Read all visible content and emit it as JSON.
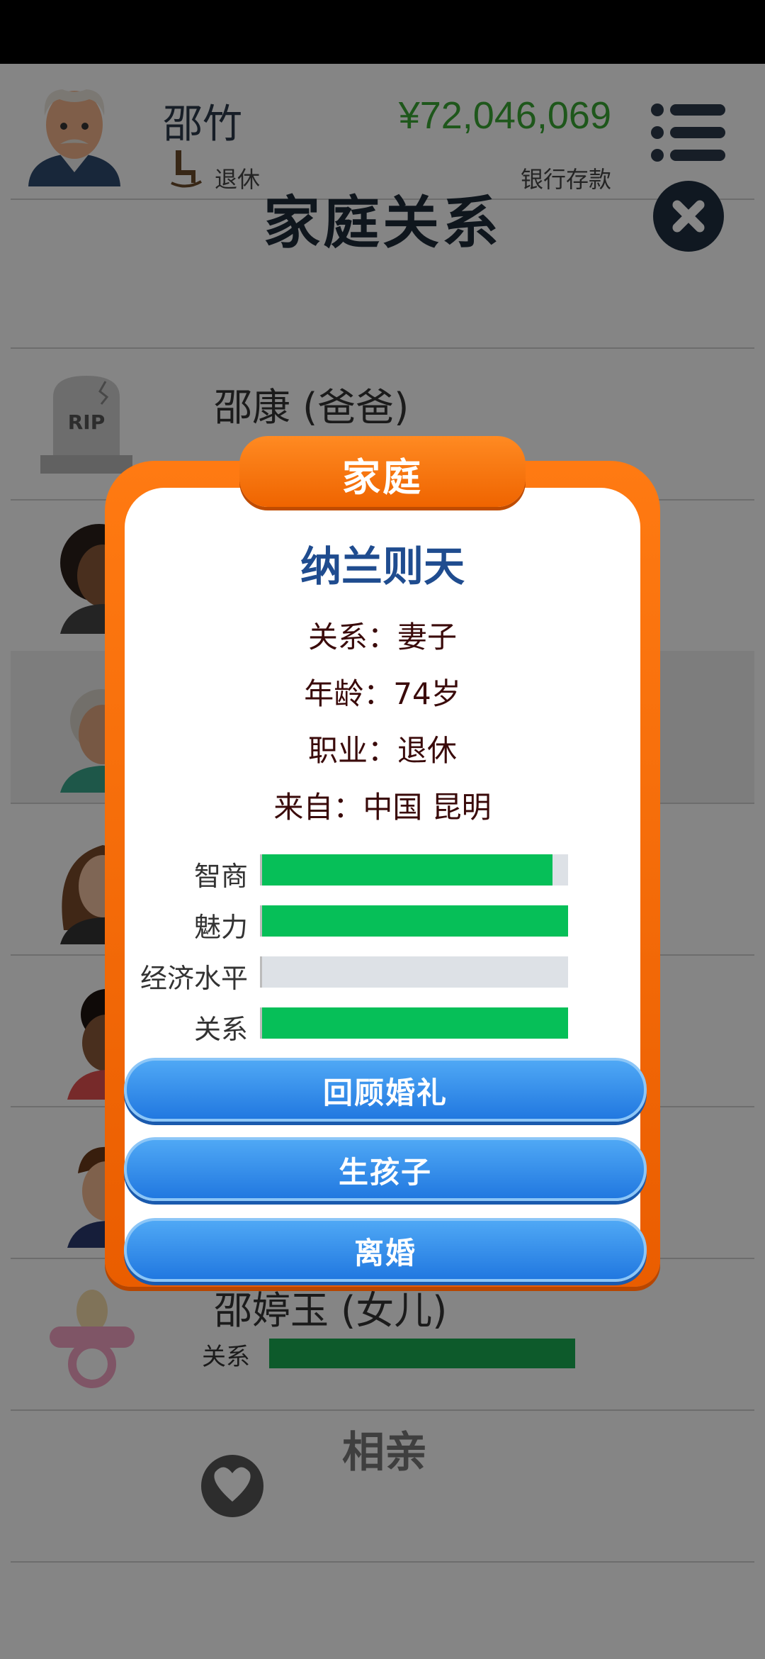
{
  "header": {
    "user_name": "邵竹",
    "job": "退休",
    "money": "¥72,046,069",
    "money_label": "银行存款",
    "avatar_icon": "old-man-avatar-icon",
    "job_icon": "rocking-chair-icon",
    "menu_icon": "menu-list-icon"
  },
  "page": {
    "title": "家庭关系",
    "close_icon": "close-icon"
  },
  "family": [
    {
      "name": "邵康 (爸爸)",
      "icon": "rip-gravestone-icon",
      "gravestone_text": "RIP"
    },
    {
      "name": "",
      "icon": "curly-hair-woman-avatar-icon"
    },
    {
      "name": "",
      "icon": "old-woman-avatar-icon"
    },
    {
      "name": "",
      "icon": "brown-hair-woman-avatar-icon"
    },
    {
      "name": "",
      "icon": "child-avatar-icon"
    },
    {
      "name": "",
      "icon": "boy-avatar-icon"
    },
    {
      "name": "邵婷玉 (女儿)",
      "icon": "pacifier-icon",
      "relation_label": "关系",
      "relation_level": 1.0
    }
  ],
  "dating": {
    "label": "相亲",
    "icon": "hearts-couple-icon"
  },
  "modal": {
    "tab_title": "家庭",
    "person_name": "纳兰则天",
    "relation": "关系：妻子",
    "age": "年龄：74岁",
    "job": "职业：退休",
    "origin": "来自：中国 昆明",
    "stats": [
      {
        "label": "智商",
        "value": 0.95
      },
      {
        "label": "魅力",
        "value": 1.0
      },
      {
        "label": "经济水平",
        "value": 0.0
      },
      {
        "label": "关系",
        "value": 1.0
      }
    ],
    "buttons": [
      "回顾婚礼",
      "生孩子",
      "离婚"
    ]
  },
  "colors": {
    "money_green": "#3aa534",
    "stat_green": "#06bf58",
    "modal_orange": "#ef6400",
    "button_blue": "#2178e0",
    "name_blue": "#1f4c8f"
  }
}
